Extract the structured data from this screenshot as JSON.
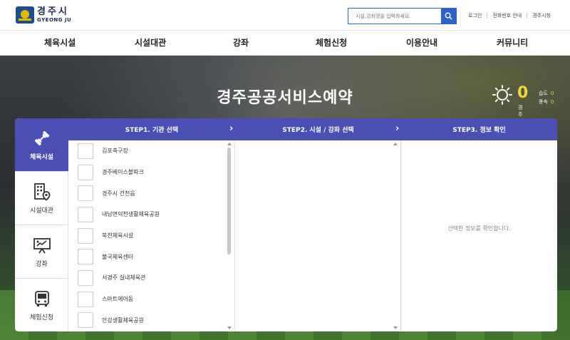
{
  "header": {
    "logo_text": "경주시",
    "logo_sub": "GYEONG JU",
    "search_placeholder": "시설,강좌명을 입력하세요.",
    "util_links": [
      "로그인",
      "전화번호 안내",
      "경주시청"
    ]
  },
  "nav": {
    "items": [
      "체육시설",
      "시설대관",
      "강좌",
      "체험신청",
      "이용안내",
      "커뮤니티"
    ]
  },
  "hero": {
    "title": "경주공공서비스예약",
    "weather": {
      "icon": "sun-icon",
      "temp": "0",
      "location": "경주",
      "humidity_label": "습도",
      "humidity_value": "0",
      "wind_label": "풍속",
      "wind_value": "0"
    }
  },
  "reservation": {
    "side_menu": [
      {
        "label": "체육시설",
        "icon": "dumbbell-icon",
        "active": true
      },
      {
        "label": "시설대관",
        "icon": "building-location-icon",
        "active": false
      },
      {
        "label": "강좌",
        "icon": "presentation-board-icon",
        "active": false
      },
      {
        "label": "체험신청",
        "icon": "bus-icon",
        "active": false
      }
    ],
    "steps": [
      "STEP1. 기관 선택",
      "STEP2. 시설 / 강좌 선택",
      "STEP3. 정보 확인"
    ],
    "facilities": [
      "김포축구장",
      "경주베이스볼파크",
      "경주시 건천읍",
      "내남면덕천생활체육공원",
      "북천체육시설",
      "불국체육센터",
      "서경주 실내체육관",
      "스마트에어돔",
      "안강생활체육공원"
    ],
    "step3_message": "선택한 정보를 확인합니다.",
    "colors": {
      "accent": "#4a4fb3",
      "search": "#2a62c9",
      "sun": "#f5d442"
    }
  }
}
